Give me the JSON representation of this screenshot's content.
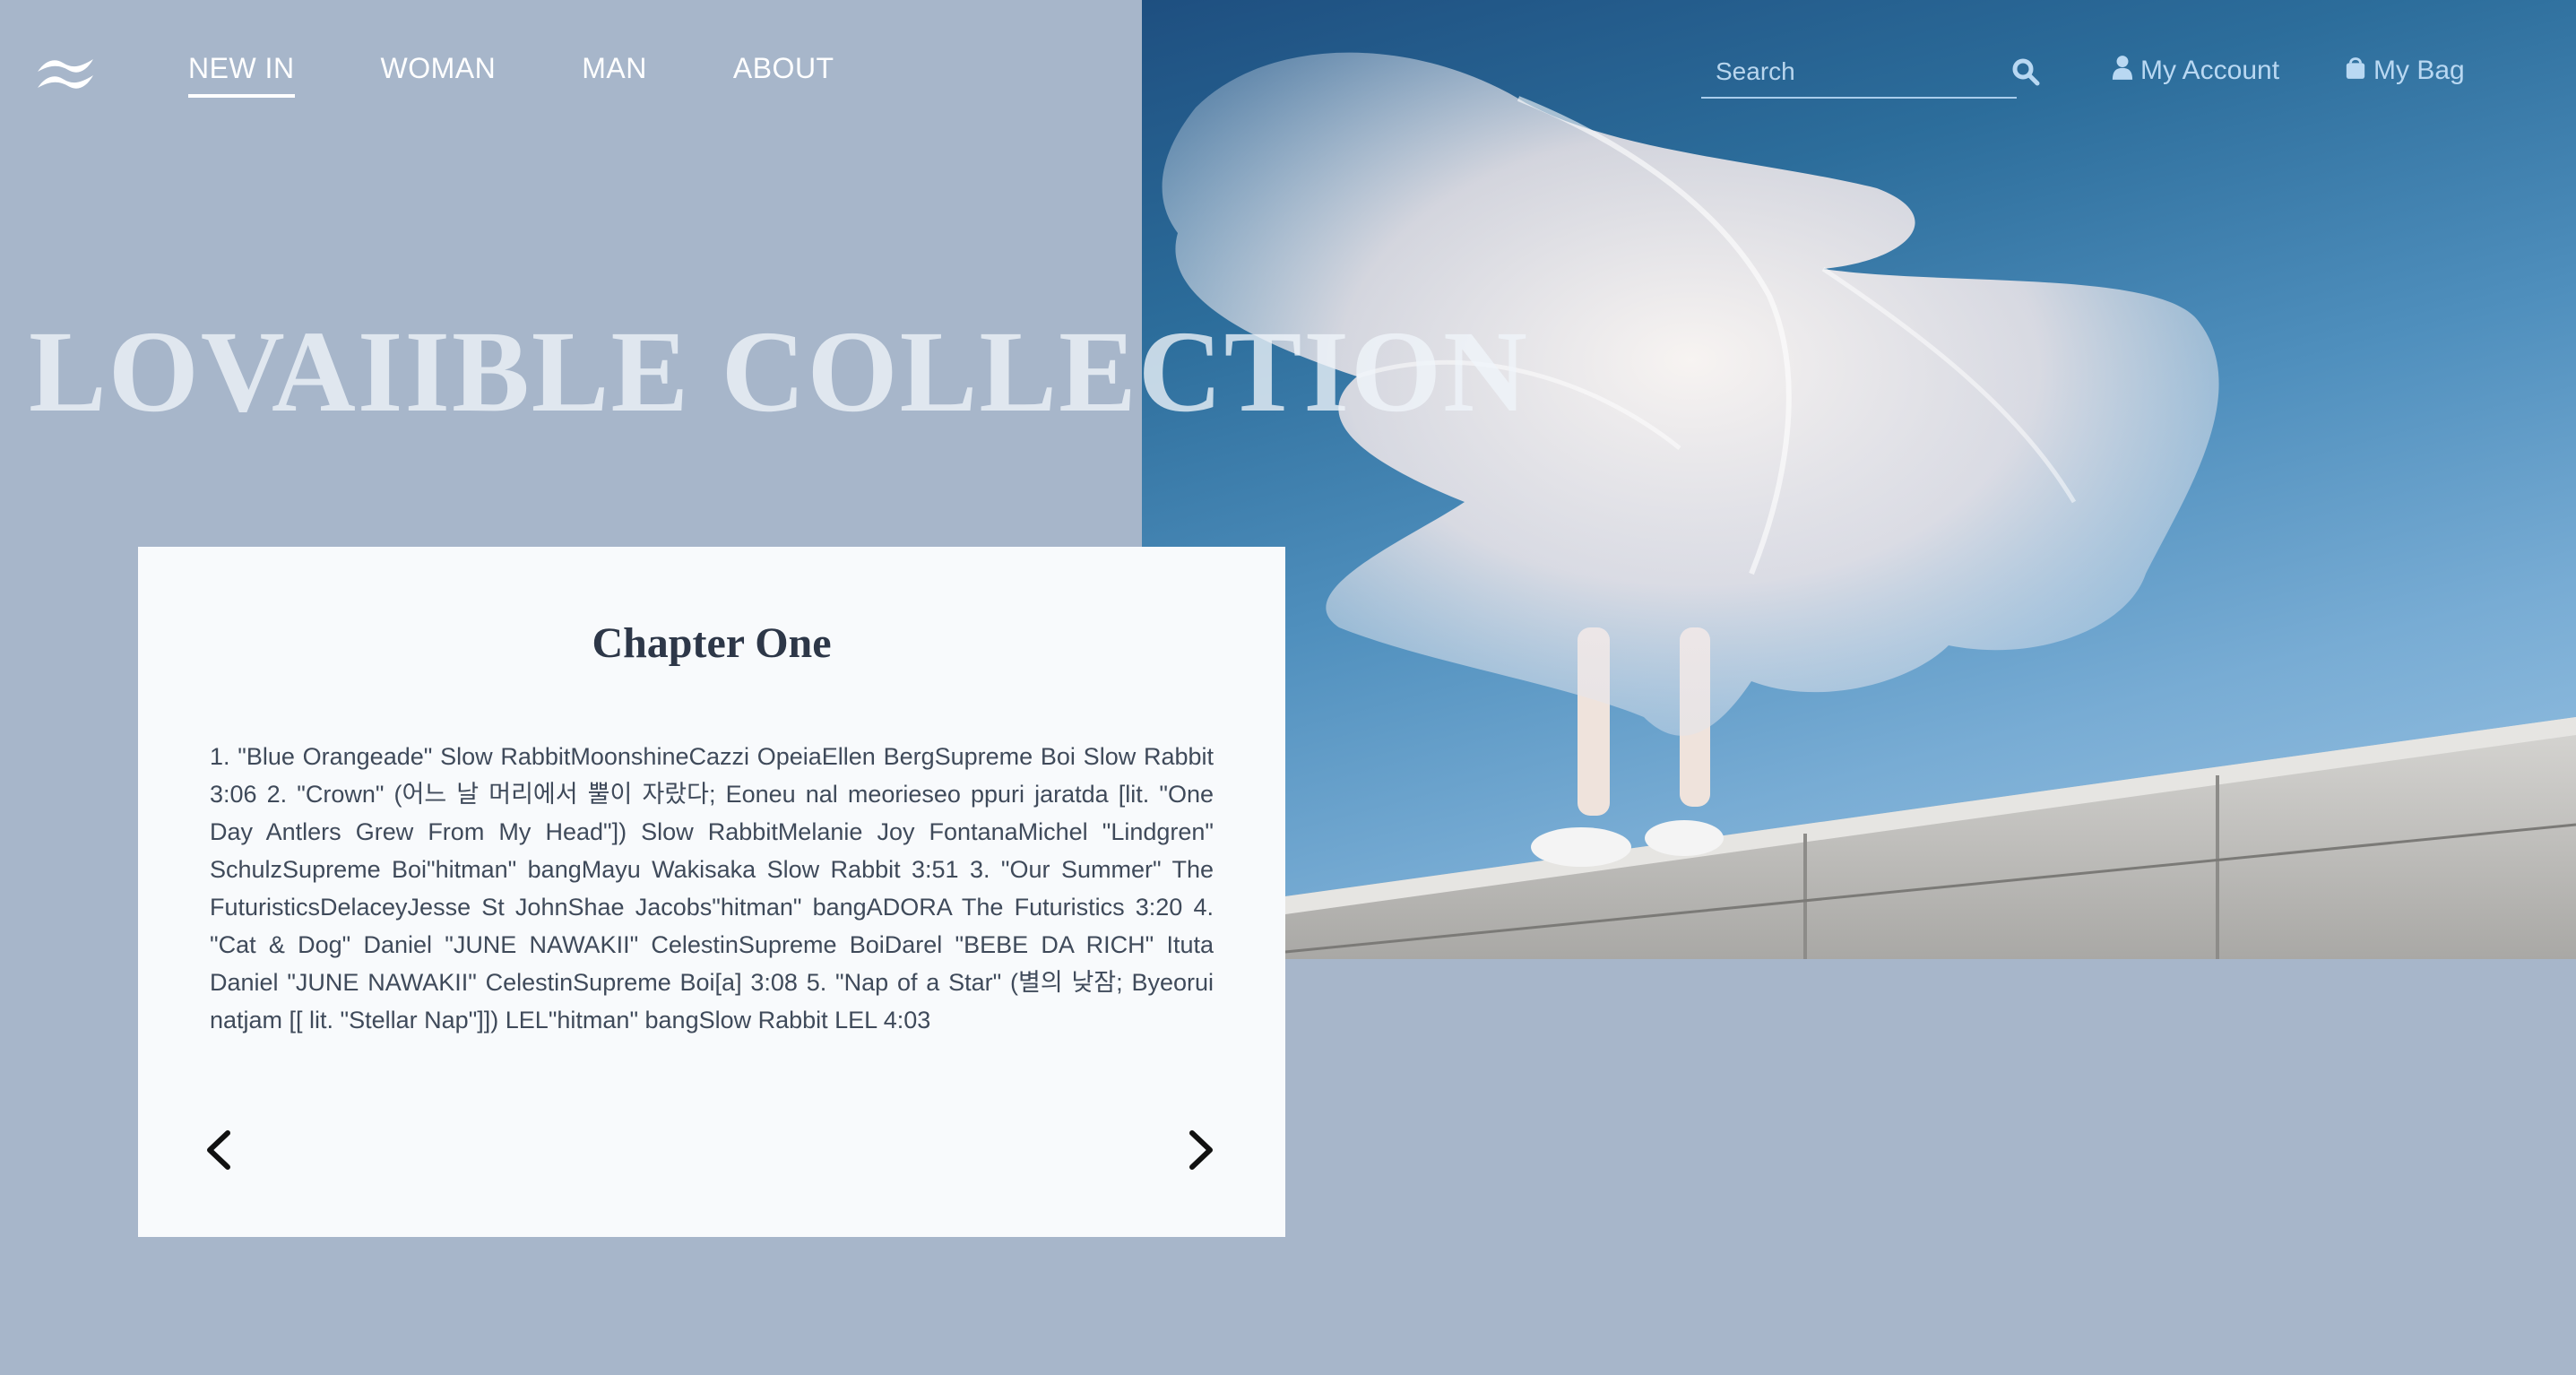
{
  "nav": {
    "links": [
      {
        "label": "NEW IN",
        "active": true
      },
      {
        "label": "WOMAN"
      },
      {
        "label": "MAN"
      },
      {
        "label": "ABOUT"
      }
    ],
    "search_placeholder": "Search",
    "account_label": "My Account",
    "bag_label": "My Bag"
  },
  "hero": {
    "title": "LOVAIIBLE COLLECTION"
  },
  "card": {
    "title": "Chapter One",
    "body": "1. \"Blue Orangeade\" Slow RabbitMoonshineCazzi OpeiaEllen BergSupreme Boi Slow Rabbit 3:06 2. \"Crown\" (어느 날 머리에서 뿔이 자랐다; Eoneu nal meorieseo ppuri jaratda [lit. \"One Day Antlers Grew From My Head\"]) Slow RabbitMelanie Joy FontanaMichel \"Lindgren\" SchulzSupreme Boi\"hitman\" bangMayu Wakisaka Slow Rabbit 3:51 3. \"Our Summer\" The FuturisticsDelaceyJesse St JohnShae Jacobs\"hitman\" bangADORA The Futuristics 3:20 4. \"Cat & Dog\" Daniel \"JUNE NAWAKII\" CelestinSupreme BoiDarel \"BEBE DA RICH\" Ituta Daniel \"JUNE NAWAKII\" CelestinSupreme Boi[a] 3:08 5. \"Nap of a Star\" (별의 낮잠; Byeorui natjam [[ lit. \"Stellar Nap\"]]) LEL\"hitman\" bangSlow Rabbit LEL 4:03"
  },
  "icons": {
    "logo": "wave-logo-icon",
    "search": "search-icon",
    "account": "user-icon",
    "bag": "shopping-bag-icon",
    "prev": "chevron-left-icon",
    "next": "chevron-right-icon"
  },
  "colors": {
    "page_background": "#a7b6ca",
    "card_background": "#f8fafc",
    "header_accent": "#b9d8f2",
    "card_title": "#2d3748"
  }
}
